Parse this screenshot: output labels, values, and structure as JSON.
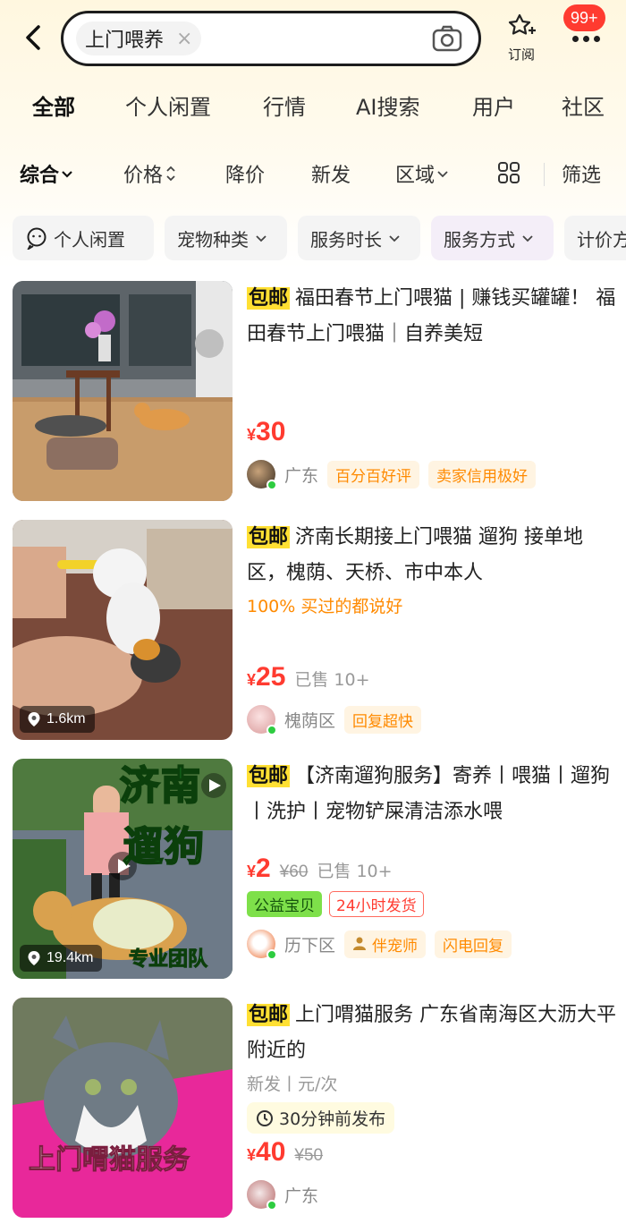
{
  "search": {
    "query": "上门喂养",
    "clear": "×"
  },
  "header": {
    "subscribe_label": "订阅",
    "badge": "99+"
  },
  "tabs": [
    "全部",
    "个人闲置",
    "行情",
    "AI搜索",
    "用户",
    "社区"
  ],
  "sort": {
    "items": [
      "综合",
      "价格",
      "降价",
      "新发",
      "区域"
    ],
    "filter": "筛选"
  },
  "filters": [
    "个人闲置",
    "宠物种类",
    "服务时长",
    "服务方式",
    "计价方"
  ],
  "listings": [
    {
      "baoyou": "包邮",
      "title": "福田春节上门喂猫 | 赚钱买罐罐！ 福田春节上门喂猫｜自养美短",
      "price": "30",
      "currency": "¥",
      "region": "广东",
      "tags": [
        "百分百好评",
        "卖家信用极好"
      ]
    },
    {
      "baoyou": "包邮",
      "title": "济南长期接上门喂猫 遛狗 接单地区，槐荫、天桥、市中本人",
      "sub": "100% 买过的都说好",
      "price": "25",
      "currency": "¥",
      "sold": "已售 10+",
      "region": "槐荫区",
      "tags": [
        "回复超快"
      ],
      "distance": "1.6km"
    },
    {
      "baoyou": "包邮",
      "title": "【济南遛狗服务】寄养丨喂猫丨遛狗丨洗护丨宠物铲屎清洁添水喂",
      "price": "2",
      "currency": "¥",
      "orig": "¥60",
      "sold": "已售 10+",
      "labels": [
        "公益宝贝",
        "24小时发货"
      ],
      "region": "历下区",
      "tags": [
        "伴宠师",
        "闪电回复"
      ],
      "distance": "19.4km",
      "overlay": [
        "济南",
        "遛狗",
        "专业团队"
      ]
    },
    {
      "baoyou": "包邮",
      "title": "上门喟猫服务 广东省南海区大沥大平附近的",
      "meta": "新发丨元/次",
      "posted": "30分钟前发布",
      "price": "40",
      "currency": "¥",
      "orig": "¥50",
      "region": "广东",
      "overlay": "上门喟猫服务"
    }
  ],
  "colors": {
    "accent": "#ffe033",
    "price": "#ff3b30",
    "orange": "#ff8a00"
  }
}
